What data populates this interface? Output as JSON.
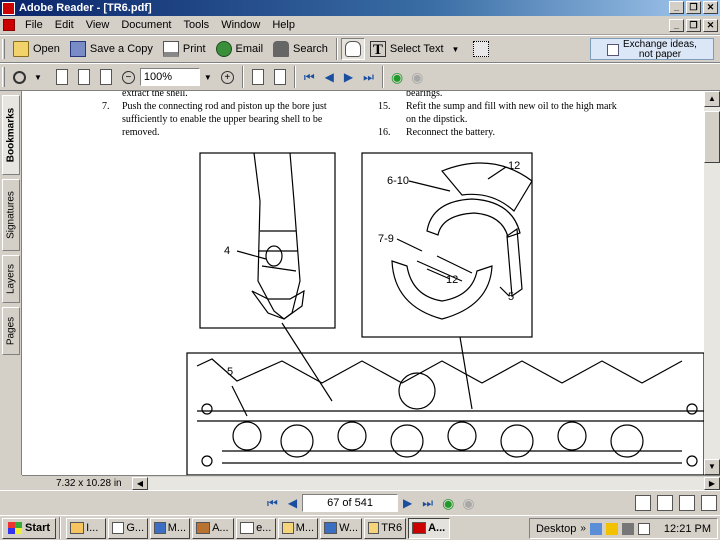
{
  "window": {
    "title": "Adobe Reader - [TR6.pdf]"
  },
  "menu": [
    "File",
    "Edit",
    "View",
    "Document",
    "Tools",
    "Window",
    "Help"
  ],
  "toolbar": {
    "open": "Open",
    "save_copy": "Save a Copy",
    "print": "Print",
    "email": "Email",
    "search": "Search",
    "select_text": "Select Text",
    "exchange_line1": "Exchange ideas,",
    "exchange_line2": "not paper"
  },
  "zoom": {
    "value": "100%"
  },
  "sidetabs": [
    "Bookmarks",
    "Signatures",
    "Layers",
    "Pages"
  ],
  "document": {
    "left_col": {
      "line0": "extract the shell.",
      "item7_num": "7.",
      "item7_l1": "Push the connecting rod and piston up the bore just",
      "item7_l2": "sufficiently to enable the upper bearing shell to be",
      "item7_l3": "removed."
    },
    "right_col": {
      "line0": "bearings.",
      "item15_num": "15.",
      "item15_l1": "Refit the sump and fill with new oil to the high mark",
      "item15_l2": "on the dipstick.",
      "item16_num": "16.",
      "item16_l1": "Reconnect the battery."
    },
    "labels": {
      "l4": "4",
      "l5_left": "5",
      "l6_10": "6-10",
      "l12_top": "12",
      "l7_9": "7-9",
      "l12_mid": "12",
      "l5_right": "5"
    }
  },
  "page_size": "7.32 x 10.28 in",
  "nav": {
    "page_display": "67 of 541"
  },
  "taskbar": {
    "start": "Start",
    "tasks": [
      "I...",
      "G...",
      "M...",
      "A...",
      "e...",
      "M...",
      "W...",
      "TR6",
      "A..."
    ],
    "desktop": "Desktop",
    "clock": "12:21 PM"
  }
}
